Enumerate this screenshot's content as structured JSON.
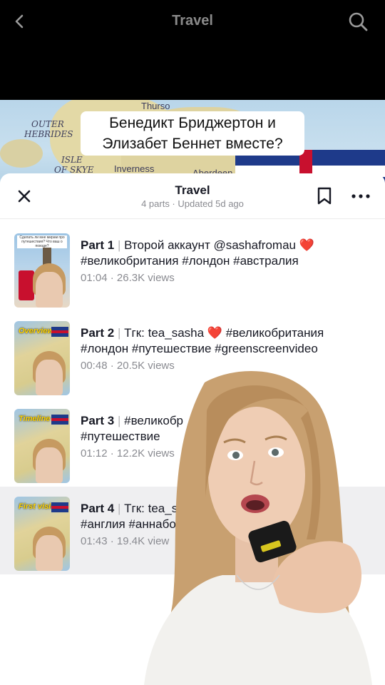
{
  "header": {
    "title": "Travel"
  },
  "video": {
    "caption_line1": "Бенедикт Бриджертон и",
    "caption_line2": "Элизабет Беннет вместе?",
    "map_labels": [
      "Thurso",
      "OUTER",
      "HEBRIDES",
      "ISLE",
      "OF SKYE",
      "Inverness",
      "Aberdeen"
    ]
  },
  "sheet": {
    "title": "Travel",
    "subtitle": "4 parts · Updated 5d ago"
  },
  "parts": [
    {
      "label": "Part 1",
      "sep": "|",
      "text_a": "Второй аккаунт @sashafromau",
      "heart": "❤️",
      "text_b": "#великобритания #лондон #австралия",
      "duration": "01:04",
      "views": "26.3K views",
      "thumb_note": "Сделать ли мне мирам про путешествия? Что ваш о походе?"
    },
    {
      "label": "Part 2",
      "sep": "|",
      "text_a": "Тгк: tea_sasha",
      "heart": "❤️",
      "text_b": "#великобритания #лондон #путешествие #greenscreenvideo",
      "duration": "00:48",
      "views": "20.5K views",
      "thumb_banner": "Overview"
    },
    {
      "label": "Part 3",
      "sep": "|",
      "text_a": "#великобр",
      "heart": "",
      "text_b": "#путешествие",
      "duration": "01:12",
      "views": "12.2K views",
      "thumb_banner": "Timeline"
    },
    {
      "label": "Part 4",
      "sep": "|",
      "text_a": "Тгк: tea_sas",
      "heart": "",
      "text_b": "#англия #аннабо",
      "duration": "01:43",
      "views": "19.4K view",
      "thumb_banner": "First visit"
    }
  ],
  "colors": {
    "heart": "#e0243a",
    "active_row": "#efeff1",
    "muted": "#8a8b91"
  }
}
